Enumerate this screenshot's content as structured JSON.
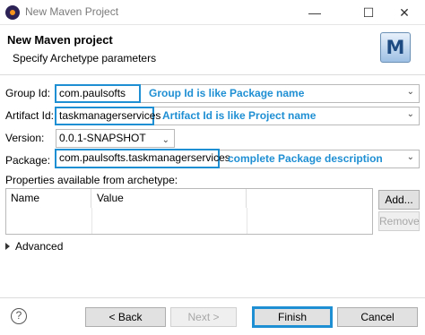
{
  "window": {
    "title": "New Maven Project",
    "controls": {
      "minimize": "—",
      "maximize": "☐",
      "close": "✕"
    }
  },
  "header": {
    "title": "New Maven project",
    "description": "Specify Archetype parameters",
    "logo_letter": "M"
  },
  "form": {
    "group_id": {
      "label": "Group Id:",
      "value": "com.paulsofts",
      "note": "Group Id is like Package name"
    },
    "artifact_id": {
      "label": "Artifact Id:",
      "value": "taskmanagerservices",
      "note": "Artifact Id is like Project name"
    },
    "version": {
      "label": "Version:",
      "value": "0.0.1-SNAPSHOT"
    },
    "package": {
      "label": "Package:",
      "value": "com.paulsofts.taskmanagerservices",
      "note": "complete Package description"
    }
  },
  "properties": {
    "label": "Properties available from archetype:",
    "columns": [
      "Name",
      "Value"
    ],
    "add_label": "Add...",
    "remove_label": "Remove"
  },
  "advanced": {
    "label": "Advanced"
  },
  "footer": {
    "help_label": "?",
    "back_label": "< Back",
    "next_label": "Next >",
    "finish_label": "Finish",
    "cancel_label": "Cancel"
  },
  "colors": {
    "highlight": "#1f8fd3",
    "note_text": "#1f8fd3"
  }
}
